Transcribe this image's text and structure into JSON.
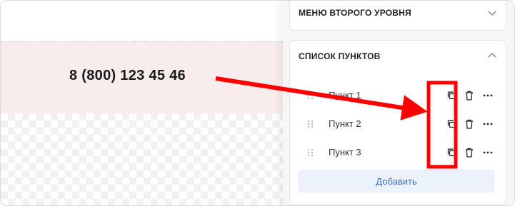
{
  "canvas": {
    "phone": "8 (800) 123 45 46"
  },
  "panel": {
    "submenu_section": {
      "title": "МЕНЮ ВТОРОГО УРОВНЯ"
    },
    "list_section": {
      "title": "СПИСОК ПУНКТОВ",
      "items": [
        {
          "label": "Пункт 1"
        },
        {
          "label": "Пункт 2"
        },
        {
          "label": "Пункт 3"
        }
      ],
      "add_label": "Добавить"
    }
  },
  "icons": {
    "chevron_collapsed": "chevron-down-icon",
    "chevron_expanded": "chevron-up-icon",
    "drag": "drag-handle-icon",
    "copy": "copy-icon",
    "delete": "trash-icon",
    "more": "more-horizontal-icon"
  },
  "colors": {
    "annotation_red": "#ff0000",
    "phone_block_bg": "#f8ecec",
    "add_button_bg": "#ecf2fb",
    "add_button_text": "#3f6fb5"
  }
}
